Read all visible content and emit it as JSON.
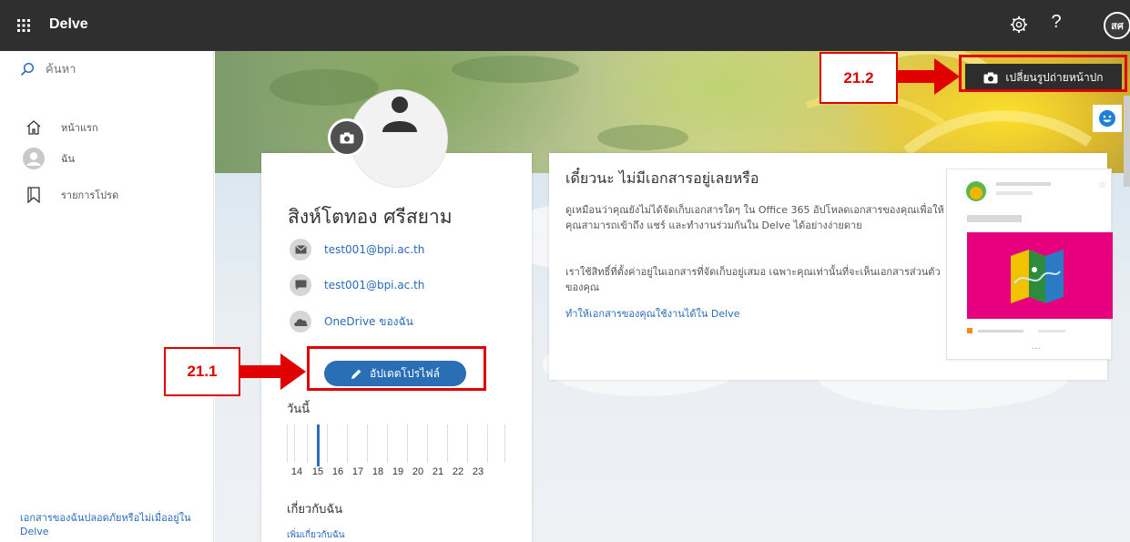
{
  "topbar": {
    "app_name": "Delve",
    "avatar_initials": "สศ",
    "help_glyph": "?",
    "icons": [
      "waffle-icon",
      "gear-icon",
      "help-icon"
    ]
  },
  "leftnav": {
    "search_placeholder": "ค้นหา",
    "items": [
      {
        "label": "หน้าแรก",
        "icon": "home-icon"
      },
      {
        "label": "ฉัน",
        "icon": "person-icon"
      },
      {
        "label": "รายการโปรด",
        "icon": "bookmark-icon"
      }
    ],
    "footer_link": "เอกสารของฉันปลอดภัยหรือไม่เมื่ออยู่ใน Delve"
  },
  "profile": {
    "name": "สิงห์โตทอง ศรีสยาม",
    "email": "test001@bpi.ac.th",
    "chat": "test001@bpi.ac.th",
    "onedrive_label": "OneDrive ของฉัน",
    "update_button": "อัปเดตโปรไฟล์",
    "today_label": "วันนี้",
    "timeline_days": [
      "14",
      "15",
      "16",
      "17",
      "18",
      "19",
      "20",
      "21",
      "22",
      "23"
    ],
    "about_label": "เกี่ยวกับฉัน",
    "about_link": "เพิ่มเกี่ยวกับฉัน"
  },
  "docs": {
    "title": "เดี๋ยวนะ ไม่มีเอกสารอยู่เลยหรือ",
    "paragraph1": "ดูเหมือนว่าคุณยังไม่ได้จัดเก็บเอกสารใดๆ ใน Office 365 อัปโหลดเอกสารของคุณเพื่อให้คุณสามารถเข้าถึง แชร์ และทำงานร่วมกันใน Delve ได้อย่างง่ายดาย",
    "paragraph2": "เราใช้สิทธิ์ที่ตั้งค่าอยู่ในเอกสารที่จัดเก็บอยู่เสมอ เฉพาะคุณเท่านั้นที่จะเห็นเอกสารส่วนตัวของคุณ",
    "link": "ทำให้เอกสารของคุณใช้งานได้ใน Delve",
    "illustration_footer": "..."
  },
  "cover": {
    "change_button": "เปลี่ยนรูปถ่ายหน้าปก"
  },
  "annotations": {
    "callout_a": "21.1",
    "callout_b": "21.2",
    "color": "#e10000"
  },
  "colors": {
    "topbar": "#2f2f2f",
    "accent": "#2a6fb5",
    "link": "#2a6ab8"
  }
}
